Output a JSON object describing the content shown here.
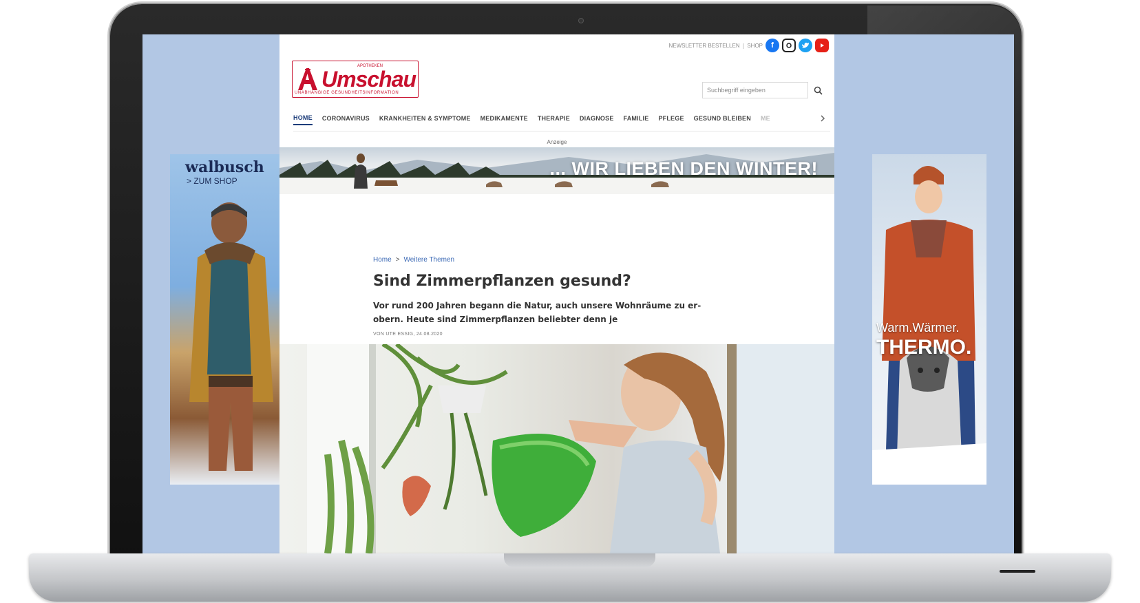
{
  "topbar": {
    "newsletter": "NEWSLETTER BESTELLEN",
    "separator": "|",
    "shop": "SHOP",
    "social_icons": [
      "facebook-icon",
      "instagram-icon",
      "twitter-icon",
      "youtube-icon"
    ]
  },
  "logo": {
    "small": "APOTHEKEN",
    "name": "Umschau",
    "tagline": "UNABHÄNGIGE GESUNDHEITSINFORMATION"
  },
  "search": {
    "placeholder": "Suchbegriff eingeben",
    "icon": "search-icon"
  },
  "nav": {
    "items": [
      {
        "label": "HOME"
      },
      {
        "label": "CORONAVIRUS"
      },
      {
        "label": "KRANKHEITEN & SYMPTOME"
      },
      {
        "label": "MEDIKAMENTE"
      },
      {
        "label": "THERAPIE"
      },
      {
        "label": "DIAGNOSE"
      },
      {
        "label": "FAMILIE"
      },
      {
        "label": "PFLEGE"
      },
      {
        "label": "GESUND BLEIBEN"
      },
      {
        "label": "ME"
      }
    ],
    "active_index": 0,
    "more_icon": "chevron-right-icon"
  },
  "ad_label": "Anzeige",
  "banner": {
    "text": "... WIR LIEBEN DEN WINTER!"
  },
  "ad_left": {
    "brand": "walbusch",
    "cta": "> ZUM SHOP"
  },
  "ad_right": {
    "line1": "Warm.Wärmer.",
    "line2": "THERMO."
  },
  "article": {
    "breadcrumb": [
      "Home",
      "Weitere Themen"
    ],
    "breadcrumb_sep": ">",
    "title": "Sind Zimmerpflanzen gesund?",
    "lead_line1": "Vor rund 200 Jahren begann die Natur, auch unsere Wohnräume zu er-",
    "lead_line2": "obern. Heute sind Zimmerpflanzen beliebter denn je",
    "byline": "VON UTE ESSIG, 24.08.2020"
  },
  "colors": {
    "brand_red": "#c8102e",
    "nav_active": "#1d3d7a",
    "link_blue": "#3a68b4",
    "page_bg": "#b2c7e4"
  }
}
